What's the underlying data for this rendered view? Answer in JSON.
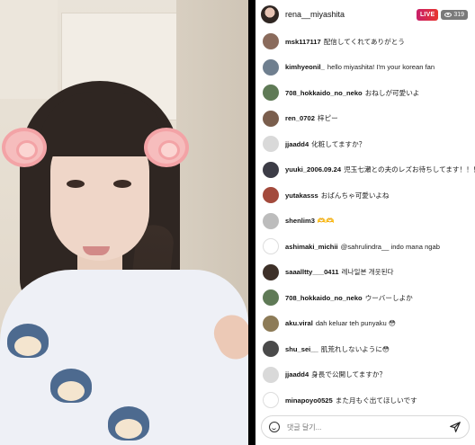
{
  "stream": {
    "host_handle": "rena__miyashita",
    "live_label": "LIVE",
    "viewer_count": "319"
  },
  "comments": [
    {
      "user": "msk117117",
      "text": "配信してくれてありがとう",
      "avatar_color": "#8a6b5c"
    },
    {
      "user": "kimhyeonil_",
      "text": "hello miyashita! I'm your korean fan",
      "avatar_color": "#6f7f8f"
    },
    {
      "user": "708_hokkaido_no_neko",
      "text": "おねしが可愛いよ",
      "avatar_color": "#5f7a56"
    },
    {
      "user": "ren_0702",
      "text": "梓ピー",
      "avatar_color": "#7a5e4d"
    },
    {
      "user": "jjaadd4",
      "text": "化粧してますか？",
      "avatar_color": "#d9d9d9"
    },
    {
      "user": "yuuki_2006.09.24",
      "text": "児玉七瀬との夫のレズお待ちしてます！！！",
      "avatar_color": "#3c3c46"
    },
    {
      "user": "yutakasss",
      "text": "おばんちゃ可愛いよね",
      "avatar_color": "#a34a3c"
    },
    {
      "user": "shenlim3",
      "text": "🫶🫶",
      "avatar_color": "#bcbcbc"
    },
    {
      "user": "ashimaki_michii",
      "text": "@sahrulindra__ indo mana ngab",
      "avatar_color": "#ffffff"
    },
    {
      "user": "saaalltty___0411",
      "text": "레나일본 개웃된다",
      "avatar_color": "#3d3028"
    },
    {
      "user": "708_hokkaido_no_neko",
      "text": "ウーバーしよか",
      "avatar_color": "#5f7a56"
    },
    {
      "user": "aku.viral",
      "text": "dah keluar teh punyaku 😳",
      "avatar_color": "#8d7b57"
    },
    {
      "user": "shu_sei__",
      "text": "肌荒れしないように😳",
      "avatar_color": "#4a4a4a"
    },
    {
      "user": "jjaadd4",
      "text": "身長で公開してますか？",
      "avatar_color": "#d9d9d9"
    },
    {
      "user": "minapoyo0525",
      "text": "また月もぐ出てほしいです",
      "avatar_color": "#ffffff"
    }
  ],
  "composer": {
    "placeholder": "댓글 달기..."
  },
  "colors": {
    "live_badge": "#d62b4e",
    "viewer_badge": "#7a7a7a"
  }
}
